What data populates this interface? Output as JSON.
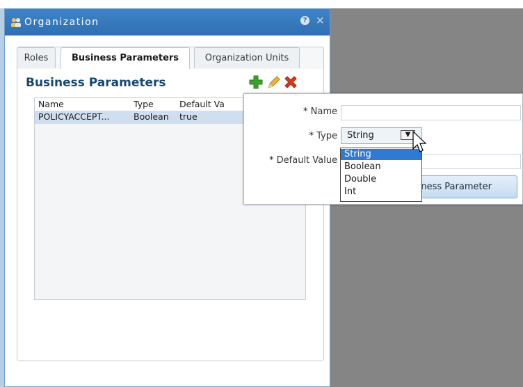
{
  "window": {
    "title": "Organization",
    "help_icon": "?",
    "close_icon": "×"
  },
  "tabs": [
    {
      "label": "Roles",
      "active": false
    },
    {
      "label": "Business Parameters",
      "active": true
    },
    {
      "label": "Organization Units",
      "active": false
    }
  ],
  "section": {
    "title": "Business Parameters",
    "toolbar": [
      "add-icon",
      "edit-icon",
      "delete-icon"
    ]
  },
  "table": {
    "columns": [
      "Name",
      "Type",
      "Default Va"
    ],
    "rows": [
      {
        "name": "POLICYACCEPT...",
        "type": "Boolean",
        "default": "true"
      }
    ]
  },
  "form": {
    "name_label": "Name",
    "type_label": "Type",
    "default_label": "Default Value",
    "required_mark": "*",
    "type_value": "String",
    "type_options": [
      "String",
      "Boolean",
      "Double",
      "Int"
    ],
    "button_label": "siness Parameter"
  },
  "colors": {
    "titlebar": "#2f6fb2",
    "heading": "#17476f",
    "selected_row": "#d0dff0",
    "selected_option": "#2f7ad3",
    "add_icon": "#3fa02b",
    "delete_icon": "#d63a1d"
  }
}
